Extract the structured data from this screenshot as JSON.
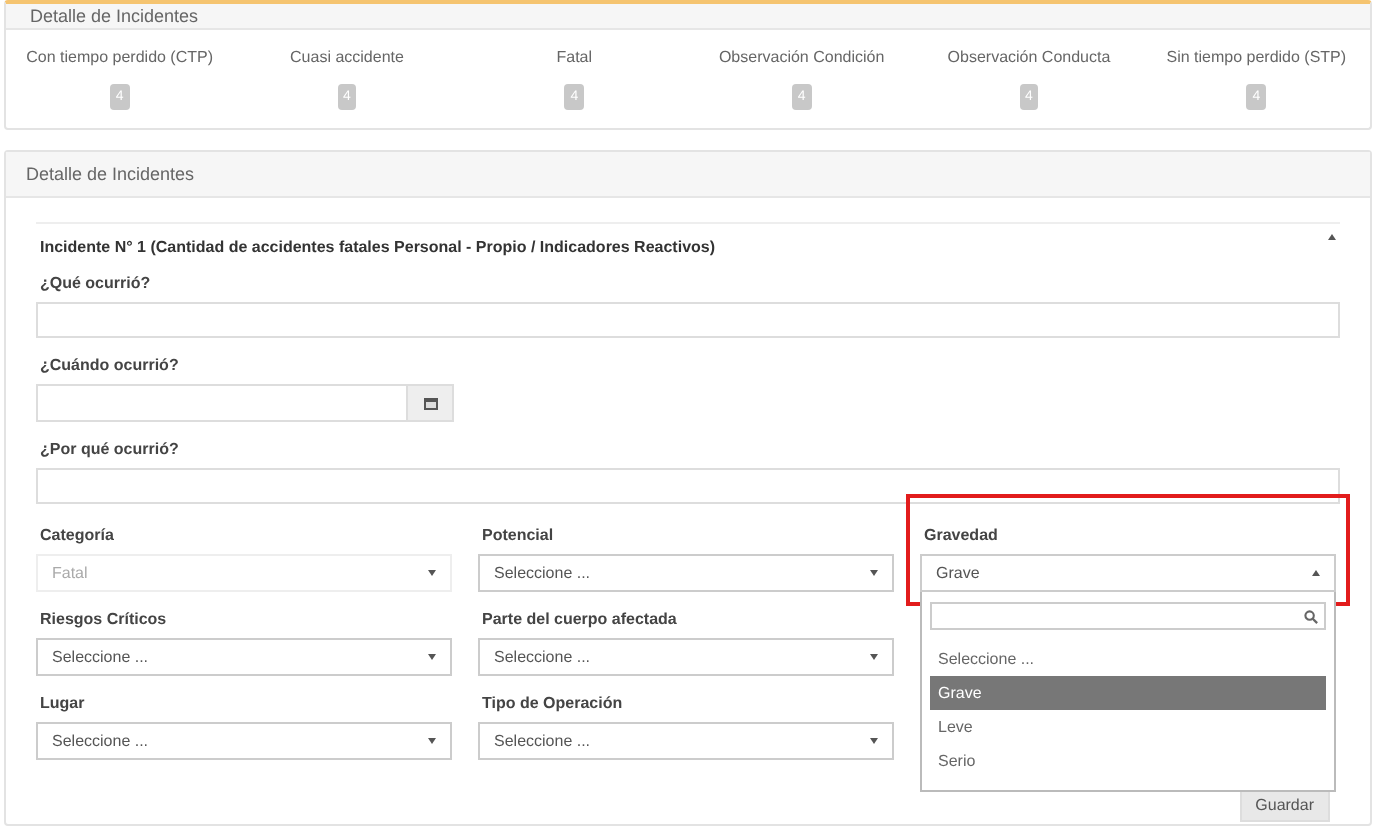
{
  "summary_panel": {
    "title": "Detalle de Incidentes",
    "counters": [
      {
        "label": "Con tiempo perdido (CTP)",
        "count": "4"
      },
      {
        "label": "Cuasi accidente",
        "count": "4"
      },
      {
        "label": "Fatal",
        "count": "4"
      },
      {
        "label": "Observación Condición",
        "count": "4"
      },
      {
        "label": "Observación Conducta",
        "count": "4"
      },
      {
        "label": "Sin tiempo perdido (STP)",
        "count": "4"
      }
    ]
  },
  "detail_panel": {
    "title": "Detalle de Incidentes",
    "incident_title": "Incidente N° 1 (Cantidad de accidentes fatales Personal - Propio / Indicadores Reactivos)",
    "text_fields": [
      {
        "label": "¿Qué ocurrió?",
        "kind": "text"
      },
      {
        "label": "¿Cuándo ocurrió?",
        "kind": "date"
      },
      {
        "label": "¿Por qué ocurrió?",
        "kind": "text"
      }
    ],
    "select_rows": [
      [
        {
          "label": "Categoría",
          "value": "Fatal",
          "disabled": true,
          "expanded": false
        },
        {
          "label": "Potencial",
          "placeholder": "Seleccione ...",
          "disabled": false,
          "expanded": false
        },
        {
          "label": "Gravedad",
          "value": "Grave",
          "disabled": false,
          "expanded": true,
          "highlighted": true,
          "options": [
            {
              "label": "Seleccione ...",
              "selected": false
            },
            {
              "label": "Grave",
              "selected": true
            },
            {
              "label": "Leve",
              "selected": false
            },
            {
              "label": "Serio",
              "selected": false
            }
          ]
        }
      ],
      [
        {
          "label": "Riesgos Críticos",
          "placeholder": "Seleccione ...",
          "disabled": false,
          "expanded": false
        },
        {
          "label": "Parte del cuerpo afectada",
          "placeholder": "Seleccione ...",
          "disabled": false,
          "expanded": false
        }
      ],
      [
        {
          "label": "Lugar",
          "placeholder": "Seleccione ...",
          "disabled": false,
          "expanded": false
        },
        {
          "label": "Tipo de Operación",
          "placeholder": "Seleccione ...",
          "disabled": false,
          "expanded": false
        }
      ]
    ],
    "save_button": "Guardar"
  }
}
